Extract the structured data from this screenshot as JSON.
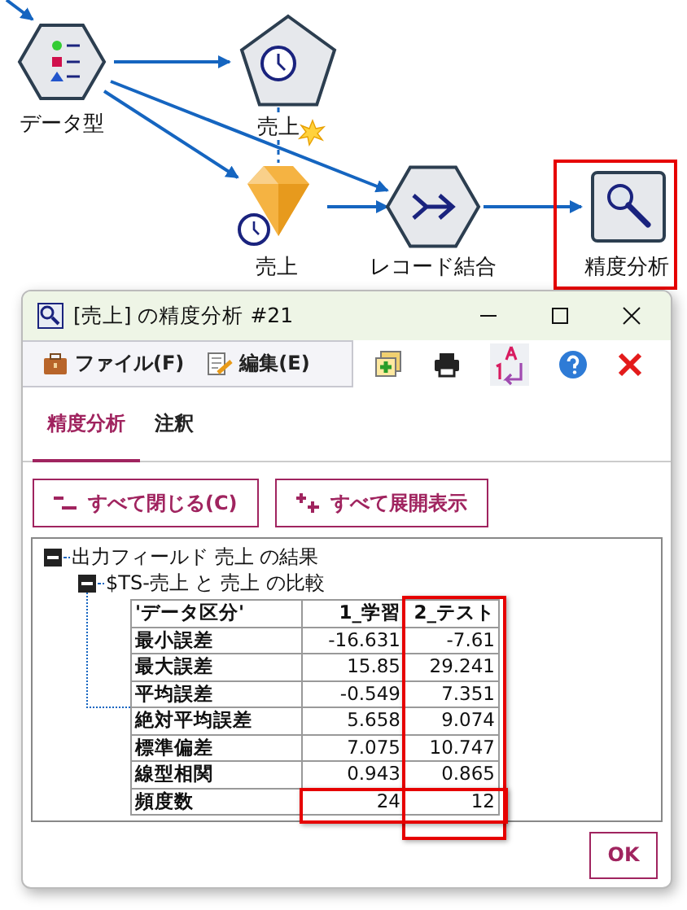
{
  "canvas": {
    "nodes": [
      {
        "label": "データ型",
        "kind": "type"
      },
      {
        "label": "売上",
        "kind": "timeseries"
      },
      {
        "label": "売上",
        "kind": "model"
      },
      {
        "label": "レコード結合",
        "kind": "merge"
      },
      {
        "label": "精度分析",
        "kind": "analysis",
        "highlighted": true
      }
    ]
  },
  "dialog": {
    "title": "[売上] の精度分析 #21",
    "menus": [
      {
        "label": "ファイル(F)",
        "kind": "file"
      },
      {
        "label": "編集(E)",
        "kind": "edit"
      }
    ],
    "tabs": [
      {
        "label": "精度分析",
        "selected": true
      },
      {
        "label": "注釈",
        "selected": false
      }
    ],
    "buttons": [
      {
        "label": "すべて閉じる(C)",
        "kind": "collapse"
      },
      {
        "label": "すべて展開表示",
        "kind": "expand"
      }
    ],
    "tree": {
      "label": "出力フィールド 売上 の結果",
      "expanded": true,
      "children": [
        {
          "label": "$TS-売上 と 売上 の比較",
          "expanded": true
        }
      ]
    },
    "table": {
      "columns": [
        {
          "label": "'データ区分'"
        },
        {
          "label": "1_学習"
        },
        {
          "label": "2_テスト",
          "highlighted": true
        }
      ],
      "rows": [
        {
          "cells": [
            "最小誤差",
            "-16.631",
            "-7.61"
          ]
        },
        {
          "cells": [
            "最大誤差",
            "15.85",
            "29.241"
          ]
        },
        {
          "cells": [
            "平均誤差",
            "-0.549",
            "7.351"
          ]
        },
        {
          "cells": [
            "絶対平均誤差",
            "5.658",
            "9.074"
          ]
        },
        {
          "cells": [
            "標準偏差",
            "7.075",
            "10.747"
          ]
        },
        {
          "cells": [
            "線型相関",
            "0.943",
            "0.865"
          ]
        },
        {
          "cells": [
            "頻度数",
            "24",
            "12"
          ],
          "highlighted": true
        }
      ]
    },
    "ok": "OK"
  }
}
